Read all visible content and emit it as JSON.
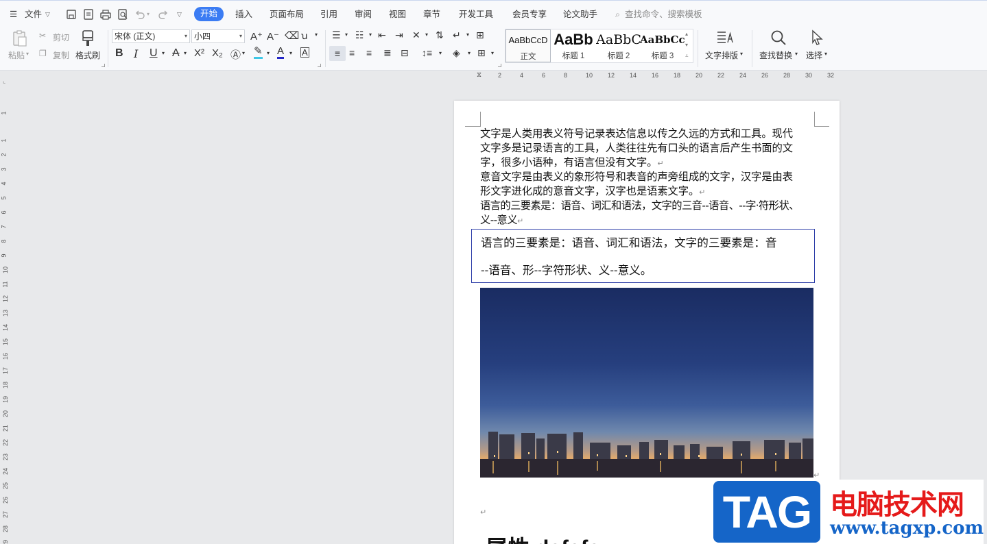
{
  "menu": {
    "file": "文件",
    "tabs": [
      "开始",
      "插入",
      "页面布局",
      "引用",
      "审阅",
      "视图",
      "章节",
      "开发工具",
      "会员专享",
      "论文助手"
    ],
    "search_placeholder": "查找命令、搜索模板"
  },
  "ribbon": {
    "paste": "粘贴",
    "cut": "剪切",
    "copy": "复制",
    "format_painter": "格式刷",
    "font_name": "宋体 (正文)",
    "font_size": "小四",
    "font_increase": "A⁺",
    "font_decrease": "A⁻",
    "bold": "B",
    "italic": "I",
    "underline": "U",
    "superscript": "X²",
    "subscript": "X₂",
    "styles": [
      {
        "preview": "AaBbCcD",
        "name": "正文"
      },
      {
        "preview": "AaBb",
        "name": "标题 1"
      },
      {
        "preview": "AaBbC",
        "name": "标题 2"
      },
      {
        "preview": "AaBbCcI",
        "name": "标题 3"
      }
    ],
    "text_layout": "文字排版",
    "find_replace": "查找替换",
    "select": "选择"
  },
  "ruler": {
    "h_ticks": [
      "2",
      "4",
      "6",
      "8",
      "10",
      "12",
      "14",
      "16",
      "18",
      "20",
      "22",
      "24",
      "26",
      "28",
      "30",
      "32"
    ],
    "v_ticks": [
      "1",
      "1",
      "2",
      "3",
      "4",
      "5",
      "6",
      "7",
      "8",
      "9",
      "10",
      "11",
      "12",
      "13",
      "14",
      "15",
      "16",
      "17",
      "18",
      "19",
      "20",
      "21",
      "22",
      "23",
      "24",
      "25",
      "26",
      "27",
      "28",
      "29"
    ]
  },
  "document": {
    "para1_lines": [
      "文字是人类用表义符号记录表达信息以传之久远的方式和工具。现代",
      "文字多是记录语言的工具，人类往往先有口头的语言后产生书面的文",
      "字，很多小语种，有语言但没有文字。"
    ],
    "para2_lines": [
      "意音文字是由表义的象形符号和表音的声旁组成的文字，汉字是由表",
      "形文字进化成的意音文字，汉字也是语素文字。"
    ],
    "para3_lines": [
      "语言的三要素是：语音、词汇和语法，文字的三音--语音、--字·符形状、",
      "义--意义"
    ],
    "paragraph_mark": "↵",
    "textbox_lines": [
      "语言的三要素是：语音、词汇和语法，文字的三要素是：音",
      "--语音、形--字符形状、义--意义。"
    ],
    "heading_partial": "属性        dafafa"
  },
  "watermark": {
    "tag": "TAG",
    "site_cn": "电脑技术网",
    "url": "www.tagxp.com"
  },
  "colors": {
    "accent": "#3b7cf3",
    "textbox_border": "#2d3ea8",
    "watermark_blue": "#1565c8",
    "watermark_red": "#e51a1a"
  }
}
